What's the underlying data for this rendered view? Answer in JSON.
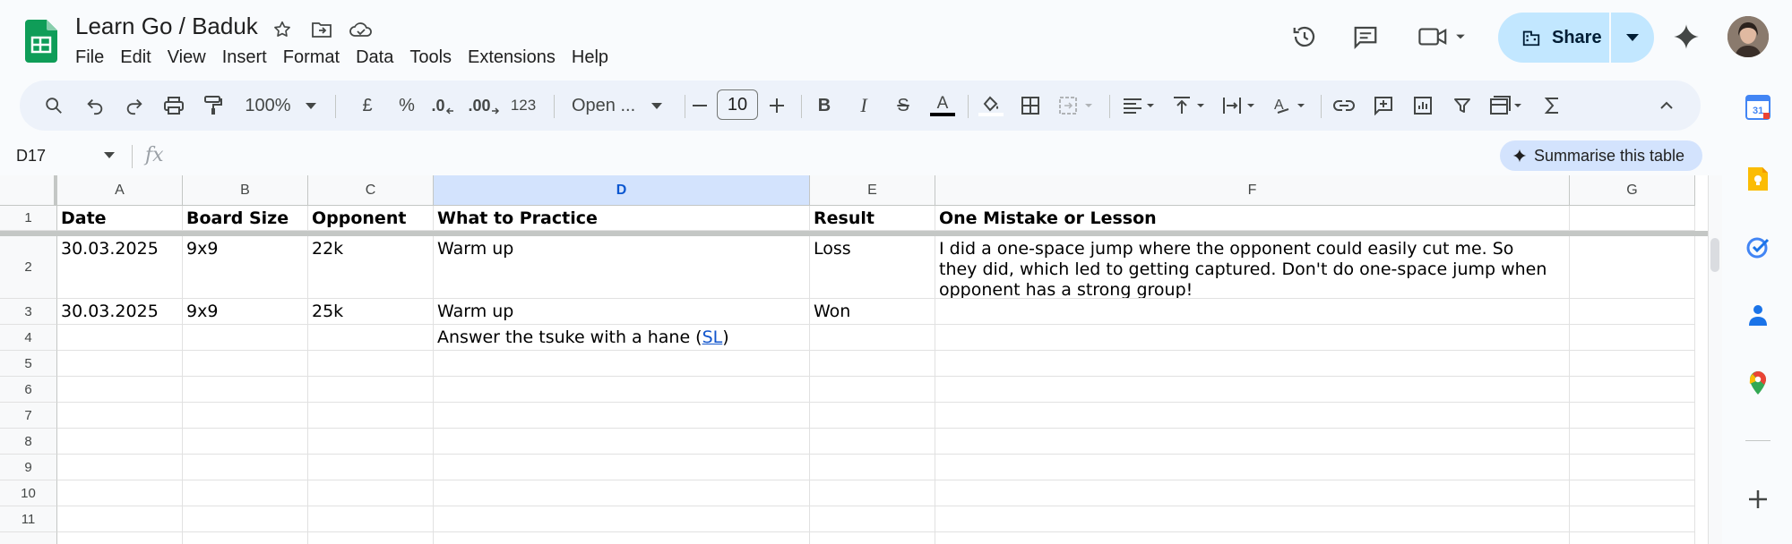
{
  "document": {
    "title": "Learn Go / Baduk"
  },
  "menu": [
    "File",
    "Edit",
    "View",
    "Insert",
    "Format",
    "Data",
    "Tools",
    "Extensions",
    "Help"
  ],
  "header": {
    "share_label": "Share"
  },
  "toolbar": {
    "zoom": "100%",
    "currency": "£",
    "percent": "%",
    "decrease_decimal": ".0",
    "increase_decimal": ".00",
    "number_format": "123",
    "font": "Open ...",
    "font_size": "10"
  },
  "formula_bar": {
    "cell_ref": "D17",
    "fx": "fx",
    "summarise_label": "Summarise this table"
  },
  "sheet": {
    "columns": [
      "A",
      "B",
      "C",
      "D",
      "E",
      "F",
      "G"
    ],
    "selected_column": "D",
    "row_numbers": [
      "1",
      "2",
      "3",
      "4",
      "5",
      "6",
      "7",
      "8",
      "9",
      "10",
      "11"
    ],
    "header_row": [
      "Date",
      "Board Size",
      "Opponent",
      "What to Practice",
      "Result",
      "One Mistake or Lesson",
      ""
    ],
    "rows": [
      [
        "30.03.2025",
        "9x9",
        "22k",
        "Warm up",
        "Loss",
        "I did a one-space jump where the opponent could easily cut me. So they did, which led to getting captured. Don't do one-space jump when opponent has a strong group!",
        ""
      ],
      [
        "30.03.2025",
        "9x9",
        "25k",
        "Warm up",
        "Won",
        "",
        ""
      ]
    ],
    "row4_d_text": "Answer the tsuke with a hane (",
    "row4_d_link": "SL",
    "row4_d_suffix": ")"
  },
  "colors": {
    "accent": "#0b57d0",
    "share_bg": "#c2e7ff",
    "toolbar_bg": "#edf2fa",
    "sheets_green": "#0f9d58",
    "link": "#1155cc"
  },
  "icons": {
    "title": [
      "star-icon",
      "move-to-folder-icon",
      "cloud-saved-icon"
    ],
    "header": [
      "version-history-icon",
      "comments-icon",
      "meet-icon",
      "gemini-icon"
    ],
    "side": [
      "calendar-icon",
      "keep-icon",
      "tasks-icon",
      "contacts-icon",
      "maps-icon",
      "add-icon"
    ]
  }
}
